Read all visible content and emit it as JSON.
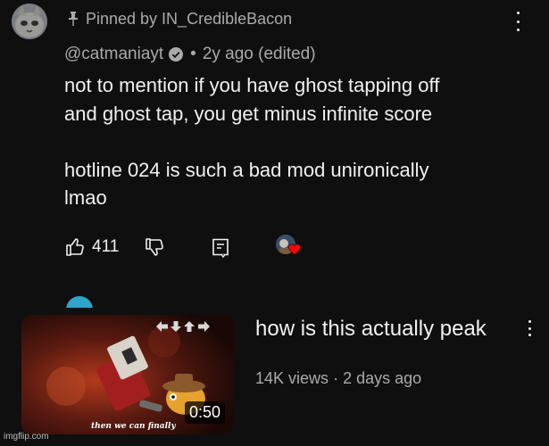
{
  "comment": {
    "pinned_text": "Pinned by IN_CredibleBacon",
    "author": "@catmaniayt",
    "time": "2y ago (edited)",
    "lines": [
      "not to mention if you have ghost tapping off",
      "and ghost tap, you get minus infinite score",
      "",
      "hotline 024 is such a bad mod unironically",
      "lmao"
    ],
    "like_count": "411",
    "icons": [
      "pin-icon",
      "verified-icon",
      "thumb-up-icon",
      "thumb-down-icon",
      "reply-icon",
      "more-vert-icon",
      "heart-icon"
    ],
    "heart_color": "#ff0000"
  },
  "video": {
    "title": "how is this actually peak",
    "views": "14K views",
    "age": "2 days ago",
    "duration": "0:50",
    "thumbnail_caption": "then we can finally"
  },
  "watermark": "imgflip.com",
  "colors": {
    "background": "#0f0f0f",
    "primary_text": "#f1f1f1",
    "secondary_text": "#aaaaaa"
  }
}
